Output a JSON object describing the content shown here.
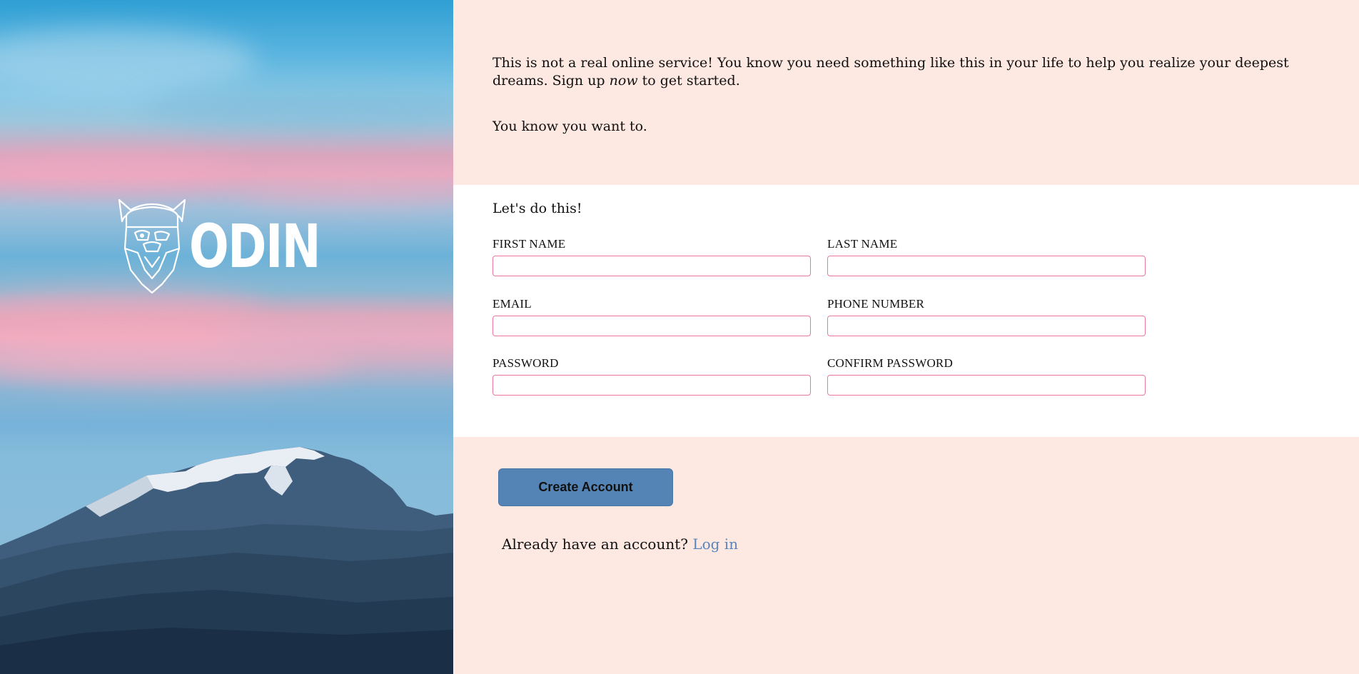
{
  "brand": {
    "logo_text": "ODIN",
    "logo_icon": "viking-helmet-icon"
  },
  "intro": {
    "line1_before": "This is not a real online service! You know you need something like this in your life to help you realize your deepest dreams. Sign up",
    "line1_emphasis": "now",
    "line1_after": "to get started.",
    "line2": "You know you want to."
  },
  "form": {
    "heading": "Let's do this!",
    "fields": {
      "first_name": {
        "label": "FIRST NAME",
        "value": ""
      },
      "last_name": {
        "label": "LAST NAME",
        "value": ""
      },
      "email": {
        "label": "EMAIL",
        "value": ""
      },
      "phone": {
        "label": "PHONE NUMBER",
        "value": ""
      },
      "password": {
        "label": "PASSWORD",
        "value": ""
      },
      "confirm_password": {
        "label": "CONFIRM PASSWORD",
        "value": ""
      }
    }
  },
  "actions": {
    "create_label": "Create Account",
    "login_prompt": "Already have an account?",
    "login_link": "Log in"
  },
  "colors": {
    "panel_bg": "#fde8e2",
    "form_bg": "#ffffff",
    "input_border": "#e8799b",
    "button_bg": "#5484b5",
    "link": "#5b84b8"
  }
}
